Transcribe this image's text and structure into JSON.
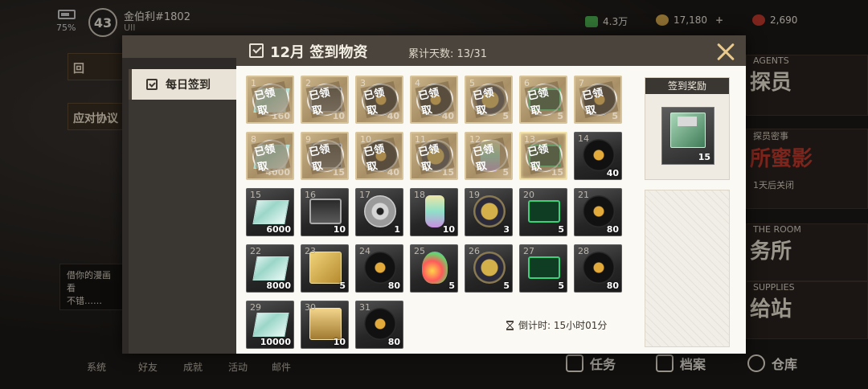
{
  "hud": {
    "battery": "75%",
    "level": "43",
    "player_name": "金伯利#1802",
    "player_uid": "UII",
    "resources": [
      {
        "icon": "cash-icon",
        "value": "4.3万",
        "color": "#4caf50"
      },
      {
        "icon": "coin-icon",
        "value": "17,180",
        "color": "#d4a84a",
        "plus": "+"
      },
      {
        "icon": "gem-icon",
        "value": "2,690",
        "color": "#c0392b"
      }
    ]
  },
  "background": {
    "left_items": [
      "回",
      "应对协议"
    ],
    "chat": "借你的漫画看\n不错……",
    "bottom_left": [
      "系统",
      "好友",
      "成就",
      "活动",
      "邮件"
    ],
    "right_cards": [
      {
        "big": "探员",
        "small": "AGENTS"
      },
      {
        "small": "探员密事",
        "big": "所蜜影",
        "note": "1天后关闭"
      },
      {
        "small": "THE ROOM",
        "big": "务所"
      },
      {
        "small": "SUPPLIES",
        "big": "给站"
      }
    ],
    "bottom_nav": [
      {
        "icon": "task-icon",
        "label": "任务"
      },
      {
        "icon": "archive-icon",
        "label": "档案"
      },
      {
        "icon": "warehouse-icon",
        "label": "仓库"
      }
    ]
  },
  "modal": {
    "sidebar_item": "每日签到",
    "title": "12月 签到物资",
    "days_label": "累计天数: 13/31",
    "claimed_text": "已领取",
    "countdown": "倒计时: 15小时01分",
    "reward_title": "签到奖励",
    "reward_qty": "15",
    "reward_icon": "floppy-disk-icon"
  },
  "days": [
    {
      "day": "1",
      "qty": "160",
      "state": "claimed",
      "icon": "cash-icon"
    },
    {
      "day": "2",
      "qty": "10",
      "state": "claimed",
      "icon": "tape-icon"
    },
    {
      "day": "3",
      "qty": "40",
      "state": "claimed",
      "icon": "record-icon"
    },
    {
      "day": "4",
      "qty": "40",
      "state": "claimed",
      "icon": "record-icon"
    },
    {
      "day": "5",
      "qty": "5",
      "state": "claimed",
      "icon": "badge-icon"
    },
    {
      "day": "6",
      "qty": "5",
      "state": "claimed",
      "icon": "green-card-icon"
    },
    {
      "day": "7",
      "qty": "5",
      "state": "claimed",
      "icon": "record-icon"
    },
    {
      "day": "8",
      "qty": "4000",
      "state": "claimed",
      "icon": "cash-icon"
    },
    {
      "day": "9",
      "qty": "15",
      "state": "claimed",
      "icon": "tape-icon"
    },
    {
      "day": "10",
      "qty": "40",
      "state": "claimed",
      "icon": "record-icon"
    },
    {
      "day": "11",
      "qty": "15",
      "state": "claimed",
      "icon": "badge-icon"
    },
    {
      "day": "12",
      "qty": "5",
      "state": "claimed",
      "icon": "bottle-icon"
    },
    {
      "day": "13",
      "qty": "15",
      "state": "claimed",
      "icon": "green-card-icon",
      "today": true
    },
    {
      "day": "14",
      "qty": "40",
      "state": "future",
      "icon": "record-icon"
    },
    {
      "day": "15",
      "qty": "6000",
      "state": "future",
      "icon": "cash-icon"
    },
    {
      "day": "16",
      "qty": "10",
      "state": "future",
      "icon": "tape-icon"
    },
    {
      "day": "17",
      "qty": "1",
      "state": "future",
      "icon": "cd-icon"
    },
    {
      "day": "18",
      "qty": "10",
      "state": "future",
      "icon": "bottle-icon"
    },
    {
      "day": "19",
      "qty": "3",
      "state": "future",
      "icon": "badge-icon"
    },
    {
      "day": "20",
      "qty": "5",
      "state": "future",
      "icon": "green-card-icon"
    },
    {
      "day": "21",
      "qty": "80",
      "state": "future",
      "icon": "record-icon"
    },
    {
      "day": "22",
      "qty": "8000",
      "state": "future",
      "icon": "cash-icon"
    },
    {
      "day": "23",
      "qty": "5",
      "state": "future",
      "icon": "gold-box-icon"
    },
    {
      "day": "24",
      "qty": "80",
      "state": "future",
      "icon": "record-icon"
    },
    {
      "day": "25",
      "qty": "5",
      "state": "future",
      "icon": "potion-icon"
    },
    {
      "day": "26",
      "qty": "5",
      "state": "future",
      "icon": "badge-icon"
    },
    {
      "day": "27",
      "qty": "5",
      "state": "future",
      "icon": "green-card-icon"
    },
    {
      "day": "28",
      "qty": "80",
      "state": "future",
      "icon": "record-icon"
    },
    {
      "day": "29",
      "qty": "10000",
      "state": "future",
      "icon": "cash-icon"
    },
    {
      "day": "30",
      "qty": "10",
      "state": "future",
      "icon": "cassette-icon"
    },
    {
      "day": "31",
      "qty": "80",
      "state": "future",
      "icon": "record-icon"
    }
  ]
}
